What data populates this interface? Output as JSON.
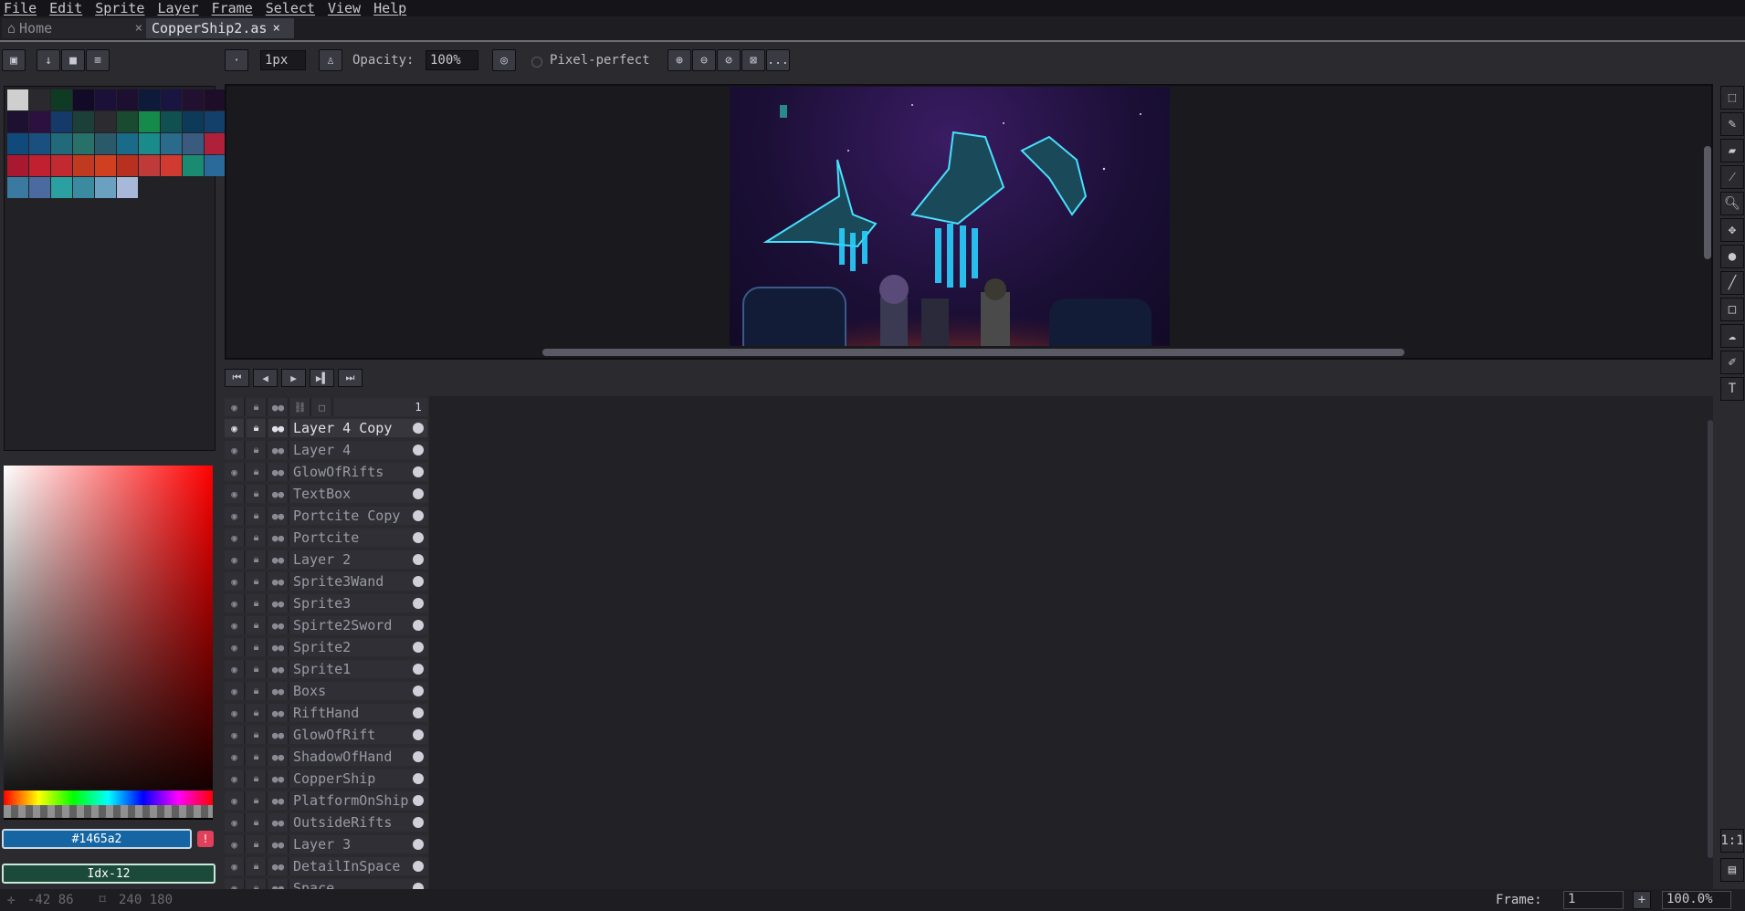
{
  "menu": [
    "File",
    "Edit",
    "Sprite",
    "Layer",
    "Frame",
    "Select",
    "View",
    "Help"
  ],
  "tabs": [
    {
      "label": "Home",
      "close": "×",
      "icon": "home-icon"
    },
    {
      "label": "CopperShip2.as",
      "close": "×"
    }
  ],
  "toolbar": {
    "brush_size": "1px",
    "opacity_label": "Opacity:",
    "opacity_value": "100%",
    "pixel_perfect_label": "Pixel-perfect",
    "more_label": "..."
  },
  "palette": {
    "colors": [
      "#cfcfcf",
      "#2a2a2e",
      "#0f3a24",
      "#120a26",
      "#1b1038",
      "#1d0f30",
      "#0e1a3a",
      "#1a1440",
      "#221030",
      "#1d0d28",
      "#1d1030",
      "#2b1040",
      "#153a6a",
      "#1d3f3a",
      "#2c2c30",
      "#1a4a30",
      "#168a4a",
      "#105050",
      "#0e3a5a",
      "#12406a",
      "#0f4a7a",
      "#1a5080",
      "#206a7a",
      "#28706a",
      "#2a5a6a",
      "#1a6a8a",
      "#1a8a8a",
      "#2a6a8a",
      "#3a5a80",
      "#b0203a",
      "#a81830",
      "#c02030",
      "#c02a30",
      "#c03a20",
      "#d04020",
      "#b83020",
      "#c03a3a",
      "#d03a30",
      "#1a8a70",
      "#2a6a9a",
      "#3a7aa0",
      "#4a6aa0",
      "#2aa0a0",
      "#3a8aa0",
      "#6aa0c0",
      "#a8b8d8"
    ]
  },
  "colors": {
    "foreground_hex": "#1465a2",
    "foreground_label": "#1465a2",
    "background_label": "Idx-12",
    "background_color": "#1c4a3a",
    "warn_symbol": "!"
  },
  "timeline": {
    "frame_number": "1",
    "layers": [
      "Layer 4 Copy",
      "Layer 4",
      "GlowOfRifts",
      "TextBox",
      "Portcite Copy",
      "Portcite",
      "Layer 2",
      "Sprite3Wand",
      "Sprite3",
      "Spirte2Sword",
      "Sprite2",
      "Sprite1",
      "Boxs",
      "RiftHand",
      "GlowOfRift",
      "ShadowOfHand",
      "CopperShip",
      "PlatformOnShip",
      "OutsideRifts",
      "Layer 3",
      "DetailInSpace",
      "Space"
    ]
  },
  "status": {
    "cursor_pos": "-42 86",
    "canvas_size": "240 180",
    "frame_label": "Frame:",
    "frame_value": "1",
    "zoom": "100.0%",
    "plus": "+"
  }
}
